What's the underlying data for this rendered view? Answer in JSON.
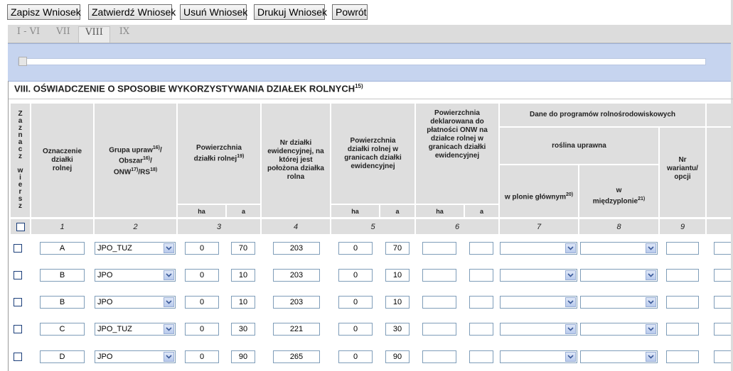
{
  "toolbar": {
    "save": "Zapisz Wniosek",
    "confirm": "Zatwierdź Wniosek",
    "delete": "Usuń Wniosek",
    "print": "Drukuj Wniosek",
    "back": "Powrót"
  },
  "tabs": [
    "I - VI",
    "VII",
    "VIII",
    "IX"
  ],
  "active_tab": "VIII",
  "section": {
    "title": "VIII. OŚWIADCZENIE O SPOSOBIE WYKORZYSTYWANIA DZIAŁEK ROLNYCH",
    "footnote": "15)"
  },
  "headers": {
    "zaznacz": [
      "Z",
      "a",
      "z",
      "n",
      "a",
      "c",
      "z",
      "",
      "w",
      "i",
      "e",
      "r",
      "s",
      "z"
    ],
    "oznaczenie": "Oznaczenie działki rolnej",
    "grupa_a": "Grupa upraw",
    "grupa_a_fn": "16)",
    "grupa_b": "Obszar",
    "grupa_b_fn": "16)",
    "grupa_c": "ONW",
    "grupa_c_fn": "17)",
    "grupa_d": "/RS",
    "grupa_d_fn": "18)",
    "powierzchnia": "Powierzchnia działki rolnej",
    "powierzchnia_fn": "19)",
    "nr_dzialki": "Nr działki ewidencyjnej, na której jest położona działka rolna",
    "pow_granice": "Powierzchnia działki rolnej w granicach działki ewidencyjnej",
    "pow_onw": "Powierzchnia deklarowana do płatności ONW na działce rolnej w granicach działki ewidencyjnej",
    "programy": "Dane do programów rolnośrodowiskowych",
    "roslina": "roślina uprawna",
    "plon_glowny": "w plonie głównym",
    "plon_glowny_fn": "20)",
    "miedzyplon": "w międzyplonie",
    "miedzyplon_fn": "21)",
    "nr_wariantu": "Nr wariantu/ opcji",
    "ha": "ha",
    "a": "a"
  },
  "column_numbers": [
    "1",
    "2",
    "3",
    "4",
    "5",
    "6",
    "7",
    "8",
    "9"
  ],
  "rows": [
    {
      "oznaczenie": "A",
      "grupa": "JPO_TUZ",
      "pow_ha": "0",
      "pow_a": "70",
      "nr": "203",
      "gr_ha": "0",
      "gr_a": "70"
    },
    {
      "oznaczenie": "B",
      "grupa": "JPO",
      "pow_ha": "0",
      "pow_a": "10",
      "nr": "203",
      "gr_ha": "0",
      "gr_a": "10"
    },
    {
      "oznaczenie": "B",
      "grupa": "JPO",
      "pow_ha": "0",
      "pow_a": "10",
      "nr": "203",
      "gr_ha": "0",
      "gr_a": "10"
    },
    {
      "oznaczenie": "C",
      "grupa": "JPO_TUZ",
      "pow_ha": "0",
      "pow_a": "30",
      "nr": "221",
      "gr_ha": "0",
      "gr_a": "30"
    },
    {
      "oznaczenie": "D",
      "grupa": "JPO",
      "pow_ha": "0",
      "pow_a": "90",
      "nr": "265",
      "gr_ha": "0",
      "gr_a": "90"
    }
  ]
}
